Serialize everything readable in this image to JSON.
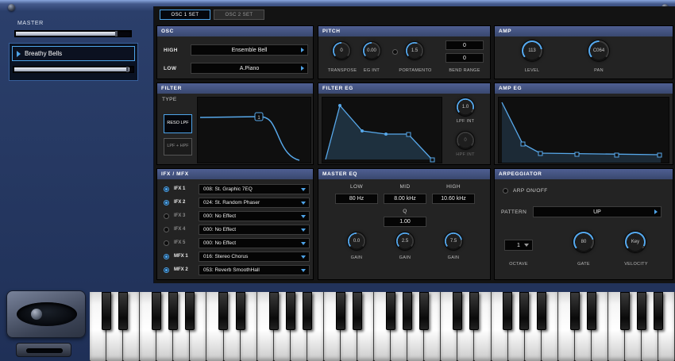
{
  "master": {
    "label": "MASTER"
  },
  "preset": {
    "name": "Breathy Bells"
  },
  "tabs": [
    {
      "label": "OSC 1 SET"
    },
    {
      "label": "OSC 2 SET"
    }
  ],
  "osc": {
    "title": "OSC",
    "rows": [
      {
        "label": "HIGH",
        "value": "Ensemble Bell"
      },
      {
        "label": "LOW",
        "value": "A.Piano"
      }
    ]
  },
  "pitch": {
    "title": "PITCH",
    "knobs": [
      {
        "value": "0",
        "label": "TRANSPOSE"
      },
      {
        "value": "0.00",
        "label": "EG INT"
      },
      {
        "value": "1.5",
        "label": "PORTAMENTO"
      }
    ],
    "bend": {
      "label": "BEND RANGE",
      "values": [
        "0",
        "0"
      ]
    }
  },
  "amp": {
    "title": "AMP",
    "knobs": [
      {
        "value": "113",
        "label": "LEVEL"
      },
      {
        "value": "C064",
        "label": "PAN"
      }
    ]
  },
  "filter": {
    "title": "FILTER",
    "type_label": "TYPE",
    "buttons": [
      {
        "label": "RESO LPF"
      },
      {
        "label": "LPF + HPF"
      }
    ],
    "node_label": "1"
  },
  "filter_eg": {
    "title": "FILTER EG",
    "knobs": [
      {
        "value": "1.0",
        "label": "LPF INT"
      },
      {
        "value": "0",
        "label": "HPF INT"
      }
    ]
  },
  "amp_eg": {
    "title": "AMP EG"
  },
  "fx": {
    "title": "IFX / MFX",
    "rows": [
      {
        "label": "IFX 1",
        "value": "008: St. Graphic 7EQ",
        "on": true
      },
      {
        "label": "IFX 2",
        "value": "024: St. Random Phaser",
        "on": true
      },
      {
        "label": "IFX 3",
        "value": "000: No Effect",
        "on": false
      },
      {
        "label": "IFX 4",
        "value": "000: No Effect",
        "on": false
      },
      {
        "label": "IFX 5",
        "value": "000: No Effect",
        "on": false
      },
      {
        "label": "MFX 1",
        "value": "016: Stereo Chorus",
        "on": true
      },
      {
        "label": "MFX 2",
        "value": "053: Reverb SmoothHall",
        "on": true
      }
    ]
  },
  "master_eq": {
    "title": "MASTER EQ",
    "bands": [
      {
        "label": "LOW",
        "freq": "80 Hz",
        "gain": "0.0"
      },
      {
        "label": "MID",
        "freq": "8.00 kHz",
        "gain": "2.5"
      },
      {
        "label": "HIGH",
        "freq": "10.60 kHz",
        "gain": "7.5"
      }
    ],
    "q_label": "Q",
    "q_value": "1.00",
    "gain_label": "GAIN"
  },
  "arp": {
    "title": "ARPEGGIATOR",
    "onoff_label": "ARP ON/OFF",
    "pattern_label": "PATTERN",
    "pattern_value": "UP",
    "octave_label": "OCTAVE",
    "octave_value": "1",
    "gate": {
      "value": "80",
      "label": "GATE"
    },
    "velocity": {
      "value": "Key",
      "label": "VELOCITY"
    }
  }
}
